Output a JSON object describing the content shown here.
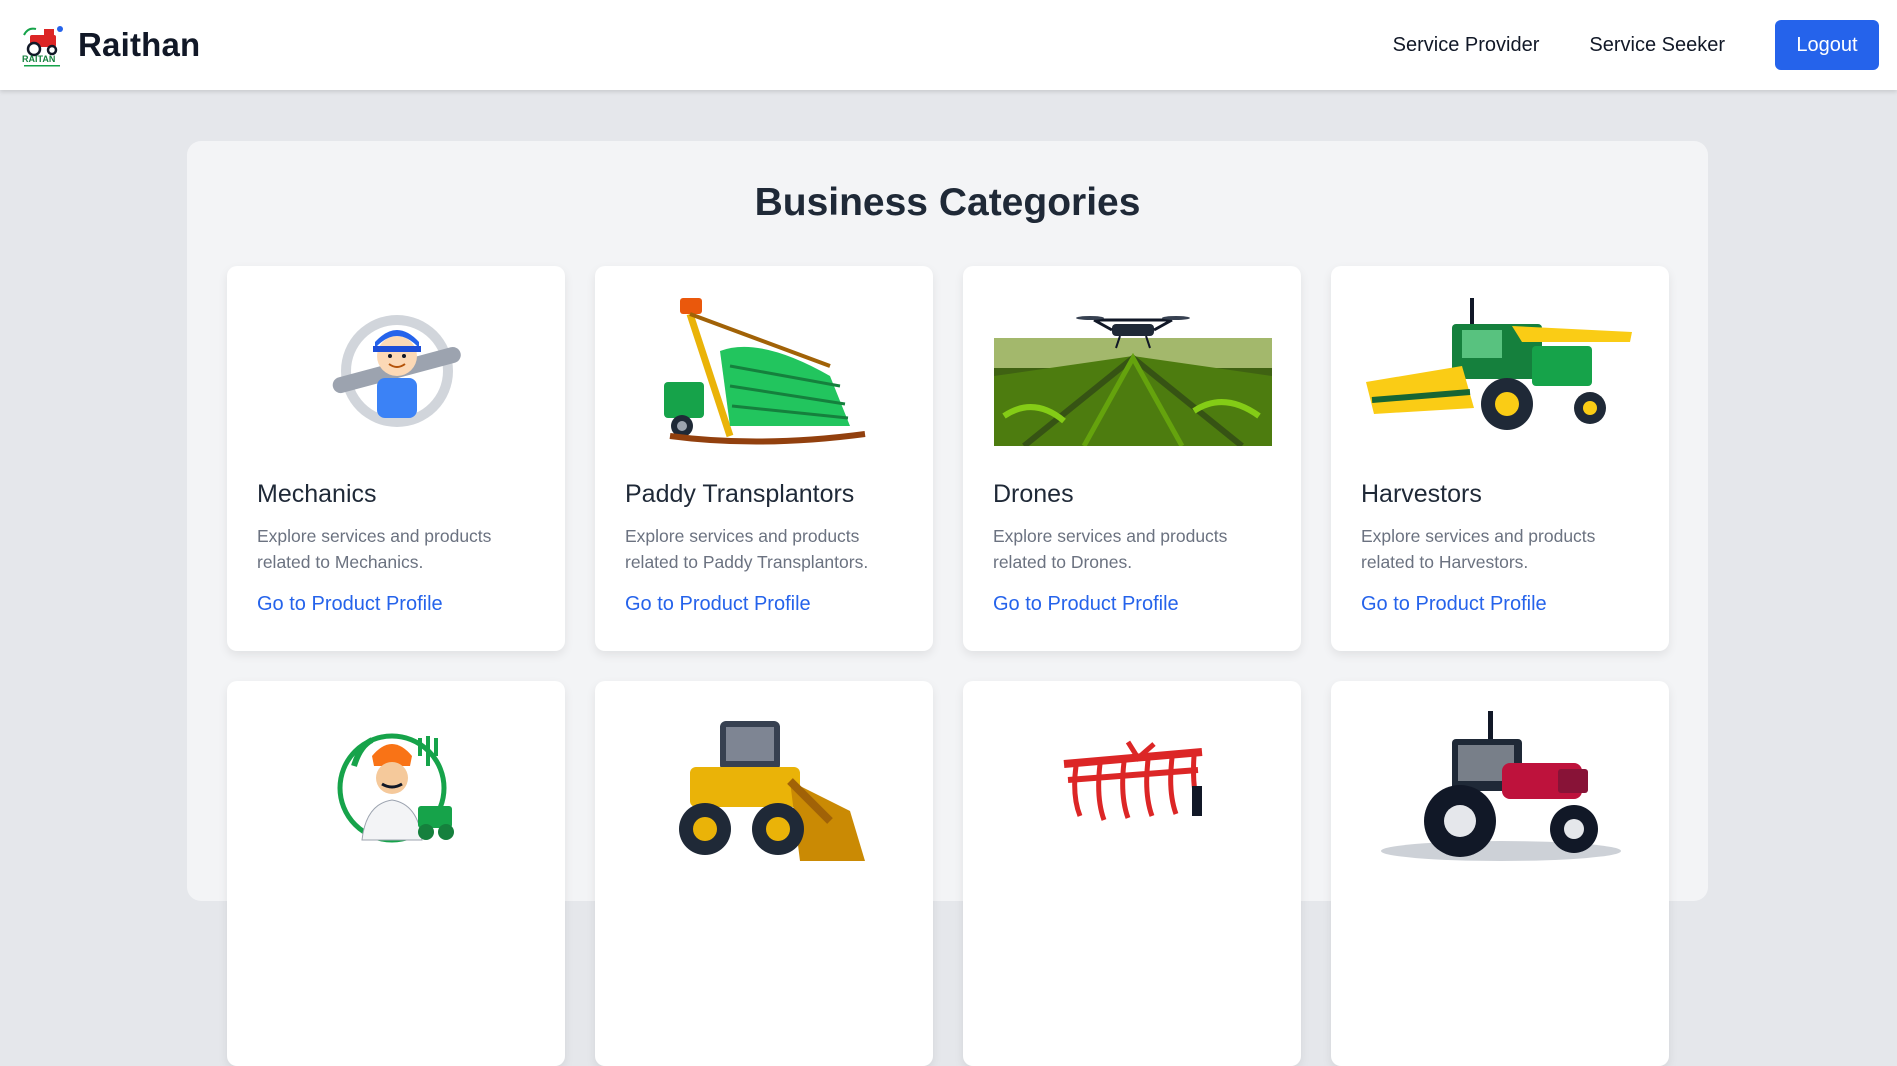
{
  "brand": {
    "name": "Raithan",
    "logo_text": "RAITAN"
  },
  "nav": {
    "links": [
      "Service Provider",
      "Service Seeker"
    ],
    "logout_label": "Logout"
  },
  "page": {
    "title": "Business Categories"
  },
  "colors": {
    "accent": "#2563eb",
    "background": "#e5e7eb",
    "panel": "#f3f4f6",
    "card": "#ffffff"
  },
  "categories": [
    {
      "title": "Mechanics",
      "description": "Explore services and products related to Mechanics.",
      "link": "Go to Product Profile",
      "icon": "mechanic-image"
    },
    {
      "title": "Paddy Transplantors",
      "description": "Explore services and products related to Paddy Transplantors.",
      "link": "Go to Product Profile",
      "icon": "paddy-transplanter-image"
    },
    {
      "title": "Drones",
      "description": "Explore services and products related to Drones.",
      "link": "Go to Product Profile",
      "icon": "drone-image"
    },
    {
      "title": "Harvestors",
      "description": "Explore services and products related to Harvestors.",
      "link": "Go to Product Profile",
      "icon": "harvester-image"
    },
    {
      "icon": "farmer-image"
    },
    {
      "icon": "wheel-loader-image"
    },
    {
      "icon": "cultivator-image"
    },
    {
      "icon": "tractor-image"
    }
  ]
}
